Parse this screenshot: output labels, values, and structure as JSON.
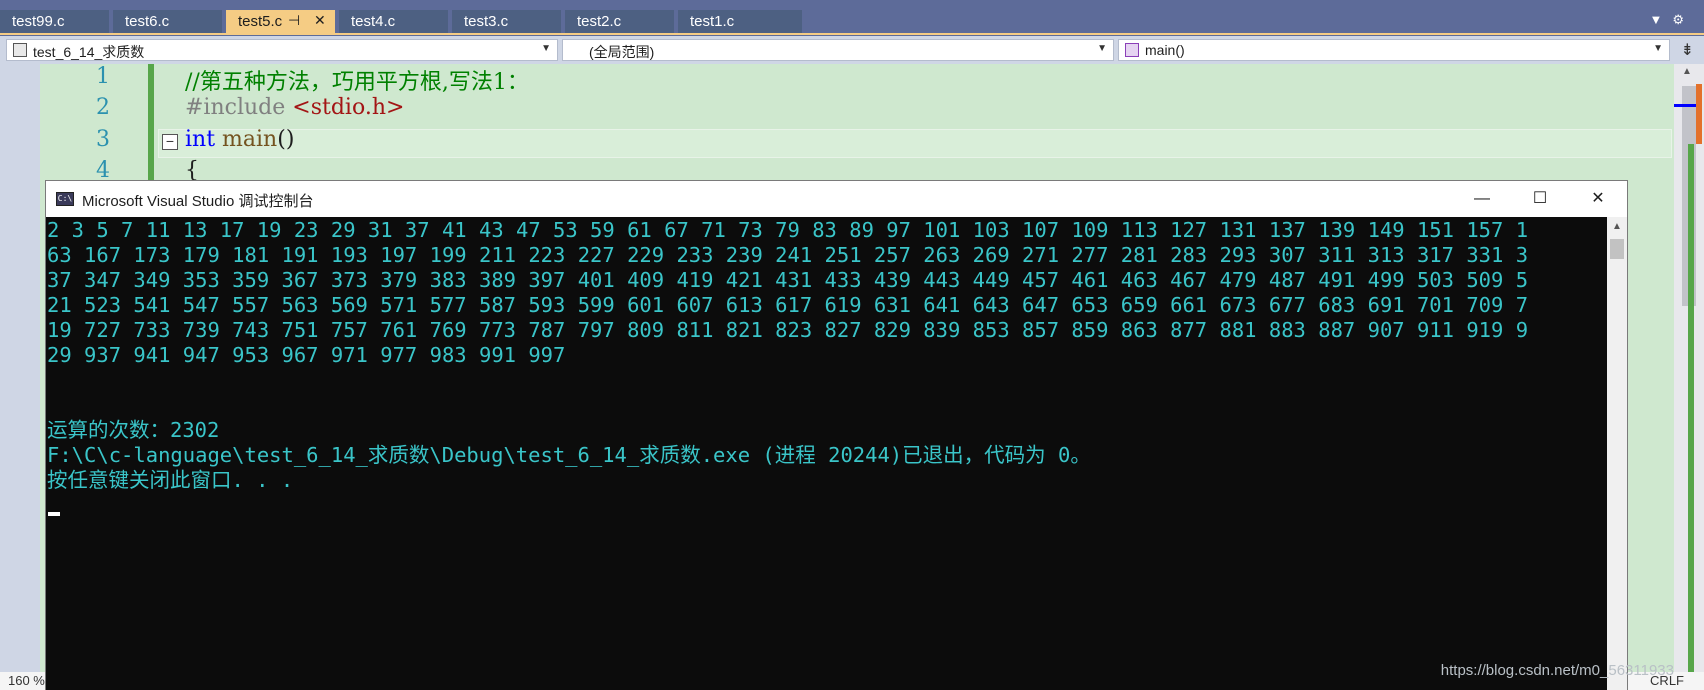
{
  "tabs": [
    {
      "label": "test99.c"
    },
    {
      "label": "test6.c"
    },
    {
      "label": "test5.c"
    },
    {
      "label": "test4.c"
    },
    {
      "label": "test3.c"
    },
    {
      "label": "test2.c"
    },
    {
      "label": "test1.c"
    }
  ],
  "active_tab": "test5.c",
  "navbar": {
    "project": "test_6_14_求质数",
    "scope": "(全局范围)",
    "member": "main()"
  },
  "editor": {
    "line_numbers": [
      "1",
      "2",
      "3",
      "4"
    ],
    "line1_comment": "//第五种方法，巧用平方根,写法1：",
    "line2_directive": "#include",
    "line2_header": "<stdio.h>",
    "line3_keyword": "int",
    "line3_func": "main",
    "line3_parens": "()",
    "line4_brace": "{"
  },
  "status": {
    "zoom": "160 %",
    "line_ending": "CRLF"
  },
  "console": {
    "title": "Microsoft Visual Studio 调试控制台",
    "icon_text": "C:\\",
    "lines": [
      "2 3 5 7 11 13 17 19 23 29 31 37 41 43 47 53 59 61 67 71 73 79 83 89 97 101 103 107 109 113 127 131 137 139 149 151 157 1",
      "63 167 173 179 181 191 193 197 199 211 223 227 229 233 239 241 251 257 263 269 271 277 281 283 293 307 311 313 317 331 3",
      "37 347 349 353 359 367 373 379 383 389 397 401 409 419 421 431 433 439 443 449 457 461 463 467 479 487 491 499 503 509 5",
      "21 523 541 547 557 563 569 571 577 587 593 599 601 607 613 617 619 631 641 643 647 653 659 661 673 677 683 691 701 709 7",
      "19 727 733 739 743 751 757 761 769 773 787 797 809 811 821 823 827 829 839 853 857 859 863 877 881 883 887 907 911 919 9",
      "29 937 941 947 953 967 971 977 983 991 997",
      "",
      "",
      "运算的次数：2302",
      "F:\\C\\c-language\\test_6_14_求质数\\Debug\\test_6_14_求质数.exe (进程 20244)已退出，代码为 0。",
      "按任意键关闭此窗口. . ."
    ]
  },
  "watermark": "https://blog.csdn.net/m0_56311933"
}
